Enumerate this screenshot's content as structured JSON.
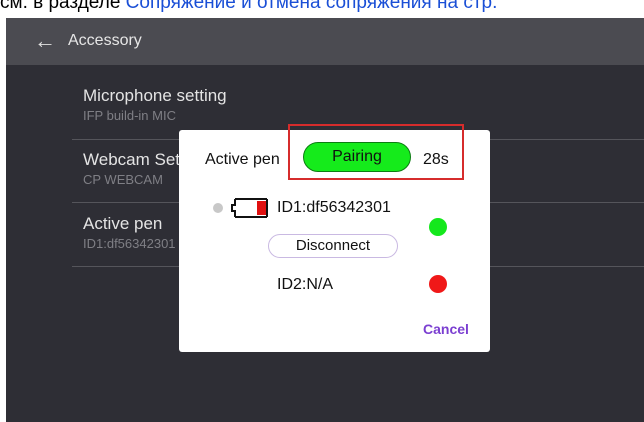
{
  "document": {
    "prefix": "см. в разделе ",
    "link": "Сопряжение и отмена сопряжения на стр."
  },
  "topbar": {
    "back_icon": "arrow-left-icon",
    "back_glyph": "←",
    "title": "Accessory"
  },
  "settings": [
    {
      "name": "Microphone setting",
      "value": "IFP build-in MIC"
    },
    {
      "name": "Webcam Setting",
      "value": "CP WEBCAM"
    },
    {
      "name": "Active pen",
      "value": "ID1:df56342301"
    }
  ],
  "dialog": {
    "label": "Active pen",
    "pairing_label": "Pairing",
    "countdown": "28s",
    "pen1": {
      "id": "ID1:df56342301",
      "status_color": "#14e81c",
      "battery_icon": "battery-low-icon"
    },
    "disconnect_label": "Disconnect",
    "pen2": {
      "id": "ID2:N/A",
      "status_color": "#f01818"
    },
    "cancel_label": "Cancel"
  },
  "colors": {
    "pairing_green": "#15eb1b",
    "highlight_red": "#d62c2c",
    "cancel_purple": "#7b3fd1",
    "topbar": "#4b4b51",
    "background": "#2e2e35"
  }
}
